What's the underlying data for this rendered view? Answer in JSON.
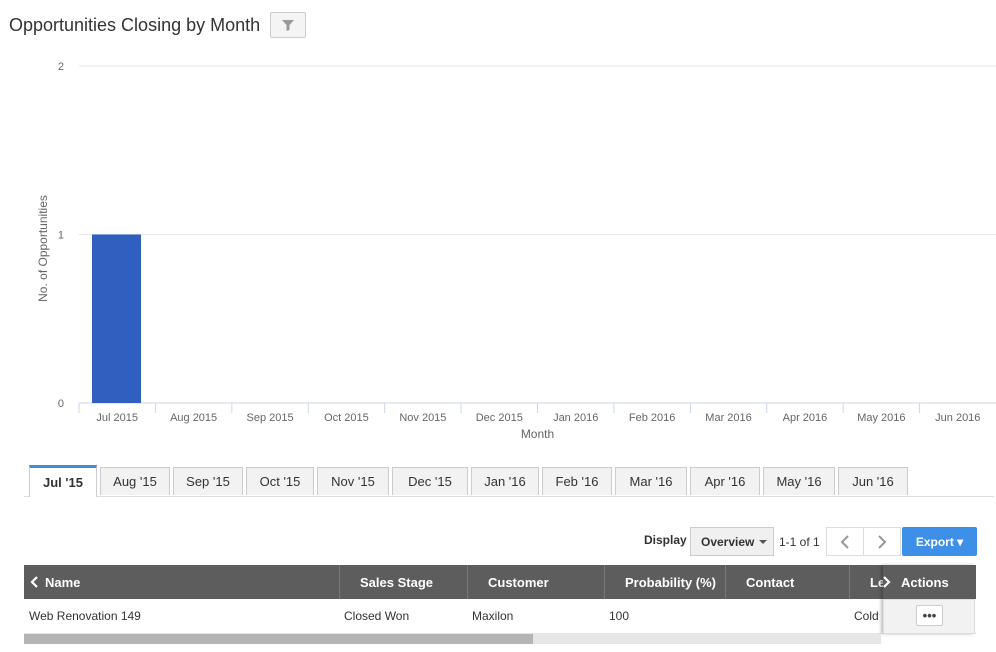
{
  "header": {
    "title": "Opportunities Closing by Month",
    "filter_icon": "filter-icon"
  },
  "chart_data": {
    "type": "bar",
    "categories": [
      "Jul 2015",
      "Aug 2015",
      "Sep 2015",
      "Oct 2015",
      "Nov 2015",
      "Dec 2015",
      "Jan 2016",
      "Feb 2016",
      "Mar 2016",
      "Apr 2016",
      "May 2016",
      "Jun 2016"
    ],
    "values": [
      1,
      0,
      0,
      0,
      0,
      0,
      0,
      0,
      0,
      0,
      0,
      0
    ],
    "xlabel": "Month",
    "ylabel": "No. of Opportunities",
    "ylim": [
      0,
      2
    ],
    "yticks": [
      "0",
      "1",
      "2"
    ],
    "grid": true,
    "bar_color": "#2f5fbf"
  },
  "tabs": [
    {
      "label": "Jul '15",
      "active": true
    },
    {
      "label": "Aug '15"
    },
    {
      "label": "Sep '15"
    },
    {
      "label": "Oct '15"
    },
    {
      "label": "Nov '15"
    },
    {
      "label": "Dec '15"
    },
    {
      "label": "Jan '16"
    },
    {
      "label": "Feb '16"
    },
    {
      "label": "Mar '16"
    },
    {
      "label": "Apr '16"
    },
    {
      "label": "May '16"
    },
    {
      "label": "Jun '16"
    }
  ],
  "toolbar": {
    "display_label": "Display",
    "display_value": "Overview",
    "pager_text": "1-1 of 1",
    "export_label": "Export ▾",
    "prev_icon": "chevron-left-icon",
    "next_icon": "chevron-right-icon"
  },
  "table": {
    "columns": [
      "Name",
      "Sales Stage",
      "Customer",
      "Probability (%)",
      "Contact",
      "Le",
      "Actions"
    ],
    "rows": [
      {
        "name": "Web Renovation 149",
        "sales_stage": "Closed Won",
        "customer": "Maxilon",
        "probability": "100",
        "contact": "",
        "lead": "Cold"
      }
    ],
    "more_label": "•••"
  },
  "colors": {
    "accent": "#3d8fe8",
    "header_bg": "#5d5d5d",
    "active_tab": "#3d8fdc"
  }
}
